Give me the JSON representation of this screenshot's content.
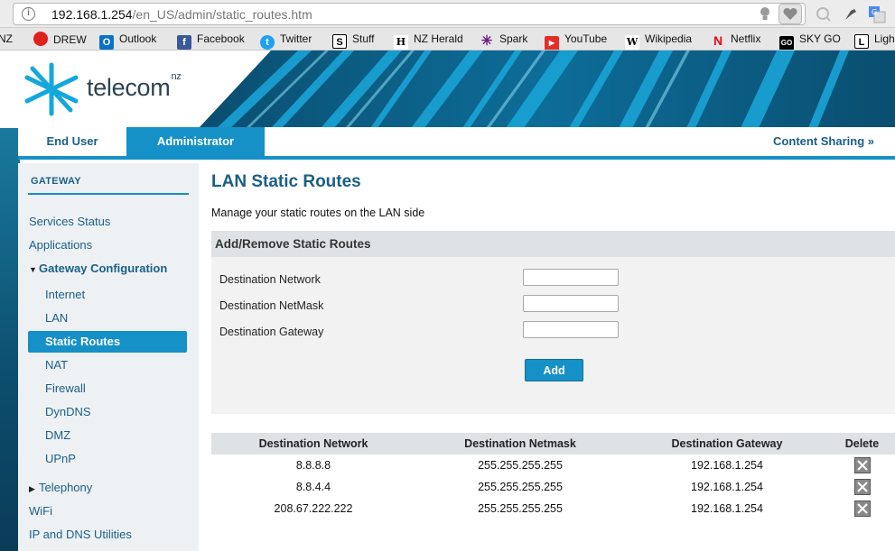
{
  "browser": {
    "url_host": "192.168.1.254",
    "url_path": "/en_US/admin/static_routes.htm"
  },
  "bookmarks": [
    {
      "label": "NZ",
      "color": "#0a5f9e"
    },
    {
      "label": "DREW",
      "color": "#e0201b"
    },
    {
      "label": "Outlook",
      "color": "#0a72c6"
    },
    {
      "label": "Facebook",
      "color": "#3b5998"
    },
    {
      "label": "Twitter",
      "color": "#1da1f2"
    },
    {
      "label": "Stuff",
      "color": "#000000"
    },
    {
      "label": "NZ Herald",
      "color": "#000000"
    },
    {
      "label": "Spark",
      "color": "#6a1b8a"
    },
    {
      "label": "YouTube",
      "color": "#e52d27"
    },
    {
      "label": "Wikipedia",
      "color": "#ffffff"
    },
    {
      "label": "Netflix",
      "color": "#e50914"
    },
    {
      "label": "SKY GO",
      "color": "#000000"
    },
    {
      "label": "Ligh",
      "color": "#000000"
    }
  ],
  "brand": {
    "name": "telecom",
    "suffix": "nz",
    "accent": "#1591c7",
    "text_blue": "#1a5f87"
  },
  "tabs": {
    "end_user": "End User",
    "administrator": "Administrator",
    "content_sharing": "Content Sharing »"
  },
  "sidebar": {
    "heading": "GATEWAY",
    "items": [
      {
        "label": "Services Status"
      },
      {
        "label": "Applications"
      },
      {
        "label": "Gateway Configuration"
      },
      {
        "label": "Internet"
      },
      {
        "label": "LAN"
      },
      {
        "label": "Static Routes"
      },
      {
        "label": "NAT"
      },
      {
        "label": "Firewall"
      },
      {
        "label": "DynDNS"
      },
      {
        "label": "DMZ"
      },
      {
        "label": "UPnP"
      },
      {
        "label": "Telephony"
      },
      {
        "label": "WiFi"
      },
      {
        "label": "IP and DNS Utilities"
      }
    ]
  },
  "main": {
    "title": "LAN Static Routes",
    "description": "Manage your static routes on the LAN side",
    "panel_title": "Add/Remove Static Routes",
    "fields": {
      "dest_network": {
        "label": "Destination Network",
        "value": ""
      },
      "dest_netmask": {
        "label": "Destination NetMask",
        "value": ""
      },
      "dest_gateway": {
        "label": "Destination Gateway",
        "value": ""
      }
    },
    "add_label": "Add",
    "table": {
      "headers": [
        "Destination Network",
        "Destination Netmask",
        "Destination Gateway",
        "Delete"
      ],
      "rows": [
        {
          "network": "8.8.8.8",
          "netmask": "255.255.255.255",
          "gateway": "192.168.1.254"
        },
        {
          "network": "8.8.4.4",
          "netmask": "255.255.255.255",
          "gateway": "192.168.1.254"
        },
        {
          "network": "208.67.222.222",
          "netmask": "255.255.255.255",
          "gateway": "192.168.1.254"
        }
      ]
    }
  }
}
